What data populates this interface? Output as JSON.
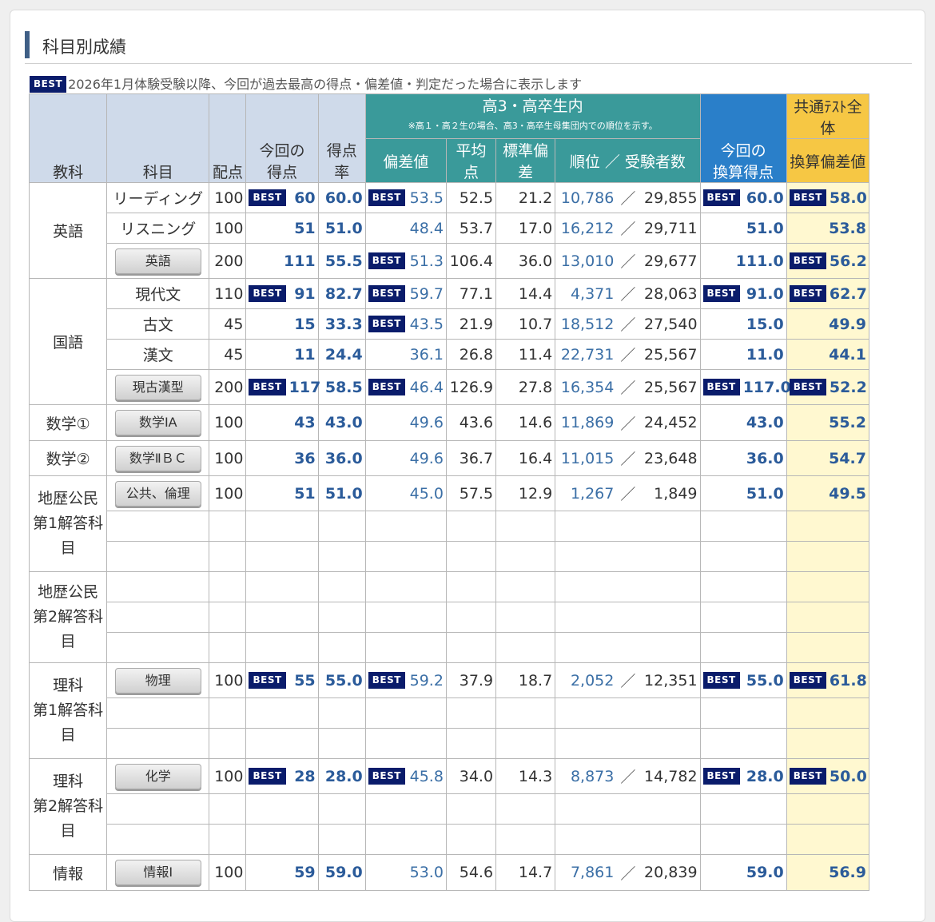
{
  "title": "科目別成績",
  "note": {
    "badge": "BEST",
    "text": "2026年1月体験受験以降、今回が過去最高の得点・偏差値・判定だった場合に表示します"
  },
  "headers": {
    "kyoka": "教科",
    "kamoku": "科目",
    "haiten": "配点",
    "konkai_tokuten_1": "今回の",
    "konkai_tokuten_2": "得点",
    "tokutenritsu": "得点率",
    "group_title": "高3・高卒生内",
    "group_note": "※高１・高２生の場合、高3・高卒生母集団内での順位を示す。",
    "hensachi": "偏差値",
    "heikin": "平均点",
    "hyojun": "標準偏差",
    "rank": "順位 ／ 受験者数",
    "kansan_1": "今回の",
    "kansan_2": "換算得点",
    "zentai": "共通ﾃｽﾄ全体",
    "kansan_hensa": "換算偏差値"
  },
  "groups": {
    "english": "英語",
    "japanese": "国語",
    "math1": "数学①",
    "math2": "数学②",
    "geo1_a": "地歴公民",
    "geo1_b": "第1解答科目",
    "geo2_a": "地歴公民",
    "geo2_b": "第2解答科目",
    "sci1_a": "理科",
    "sci1_b": "第1解答科目",
    "sci2_a": "理科",
    "sci2_b": "第2解答科目",
    "info": "情報"
  },
  "rows": [
    {
      "subject": "リーディング",
      "button": false,
      "haiten": "100",
      "score": "60",
      "score_best": true,
      "rate": "60.0",
      "hensa": "53.5",
      "hensa_best": true,
      "avg": "52.5",
      "sd": "21.2",
      "rank": "10,786",
      "takers": "29,855",
      "conv": "60.0",
      "conv_best": true,
      "total": "58.0",
      "total_best": true
    },
    {
      "subject": "リスニング",
      "button": false,
      "haiten": "100",
      "score": "51",
      "score_best": false,
      "rate": "51.0",
      "hensa": "48.4",
      "hensa_best": false,
      "avg": "53.7",
      "sd": "17.0",
      "rank": "16,212",
      "takers": "29,711",
      "conv": "51.0",
      "conv_best": false,
      "total": "53.8",
      "total_best": false
    },
    {
      "subject": "英語",
      "button": true,
      "haiten": "200",
      "score": "111",
      "score_best": false,
      "rate": "55.5",
      "hensa": "51.3",
      "hensa_best": true,
      "avg": "106.4",
      "sd": "36.0",
      "rank": "13,010",
      "takers": "29,677",
      "conv": "111.0",
      "conv_best": false,
      "total": "56.2",
      "total_best": true
    },
    {
      "subject": "現代文",
      "button": false,
      "haiten": "110",
      "score": "91",
      "score_best": true,
      "rate": "82.7",
      "hensa": "59.7",
      "hensa_best": true,
      "avg": "77.1",
      "sd": "14.4",
      "rank": "4,371",
      "takers": "28,063",
      "conv": "91.0",
      "conv_best": true,
      "total": "62.7",
      "total_best": true
    },
    {
      "subject": "古文",
      "button": false,
      "haiten": "45",
      "score": "15",
      "score_best": false,
      "rate": "33.3",
      "hensa": "43.5",
      "hensa_best": true,
      "avg": "21.9",
      "sd": "10.7",
      "rank": "18,512",
      "takers": "27,540",
      "conv": "15.0",
      "conv_best": false,
      "total": "49.9",
      "total_best": false
    },
    {
      "subject": "漢文",
      "button": false,
      "haiten": "45",
      "score": "11",
      "score_best": false,
      "rate": "24.4",
      "hensa": "36.1",
      "hensa_best": false,
      "avg": "26.8",
      "sd": "11.4",
      "rank": "22,731",
      "takers": "25,567",
      "conv": "11.0",
      "conv_best": false,
      "total": "44.1",
      "total_best": false
    },
    {
      "subject": "現古漢型",
      "button": true,
      "haiten": "200",
      "score": "117",
      "score_best": true,
      "rate": "58.5",
      "hensa": "46.4",
      "hensa_best": true,
      "avg": "126.9",
      "sd": "27.8",
      "rank": "16,354",
      "takers": "25,567",
      "conv": "117.0",
      "conv_best": true,
      "total": "52.2",
      "total_best": true
    },
    {
      "subject": "数学ⅠA",
      "button": true,
      "haiten": "100",
      "score": "43",
      "score_best": false,
      "rate": "43.0",
      "hensa": "49.6",
      "hensa_best": false,
      "avg": "43.6",
      "sd": "14.6",
      "rank": "11,869",
      "takers": "24,452",
      "conv": "43.0",
      "conv_best": false,
      "total": "55.2",
      "total_best": false
    },
    {
      "subject": "数学ⅡＢＣ",
      "button": true,
      "haiten": "100",
      "score": "36",
      "score_best": false,
      "rate": "36.0",
      "hensa": "49.6",
      "hensa_best": false,
      "avg": "36.7",
      "sd": "16.4",
      "rank": "11,015",
      "takers": "23,648",
      "conv": "36.0",
      "conv_best": false,
      "total": "54.7",
      "total_best": false
    },
    {
      "subject": "公共、倫理",
      "button": true,
      "haiten": "100",
      "score": "51",
      "score_best": false,
      "rate": "51.0",
      "hensa": "45.0",
      "hensa_best": false,
      "avg": "57.5",
      "sd": "12.9",
      "rank": "1,267",
      "takers": "1,849",
      "conv": "51.0",
      "conv_best": false,
      "total": "49.5",
      "total_best": false
    },
    {
      "subject": "物理",
      "button": true,
      "haiten": "100",
      "score": "55",
      "score_best": true,
      "rate": "55.0",
      "hensa": "59.2",
      "hensa_best": true,
      "avg": "37.9",
      "sd": "18.7",
      "rank": "2,052",
      "takers": "12,351",
      "conv": "55.0",
      "conv_best": true,
      "total": "61.8",
      "total_best": true
    },
    {
      "subject": "化学",
      "button": true,
      "haiten": "100",
      "score": "28",
      "score_best": true,
      "rate": "28.0",
      "hensa": "45.8",
      "hensa_best": true,
      "avg": "34.0",
      "sd": "14.3",
      "rank": "8,873",
      "takers": "14,782",
      "conv": "28.0",
      "conv_best": true,
      "total": "50.0",
      "total_best": true
    },
    {
      "subject": "情報Ⅰ",
      "button": true,
      "haiten": "100",
      "score": "59",
      "score_best": false,
      "rate": "59.0",
      "hensa": "53.0",
      "hensa_best": false,
      "avg": "54.6",
      "sd": "14.7",
      "rank": "7,861",
      "takers": "20,839",
      "conv": "59.0",
      "conv_best": false,
      "total": "56.9",
      "total_best": false
    }
  ],
  "best_label": "BEST",
  "rank_sep": "／"
}
